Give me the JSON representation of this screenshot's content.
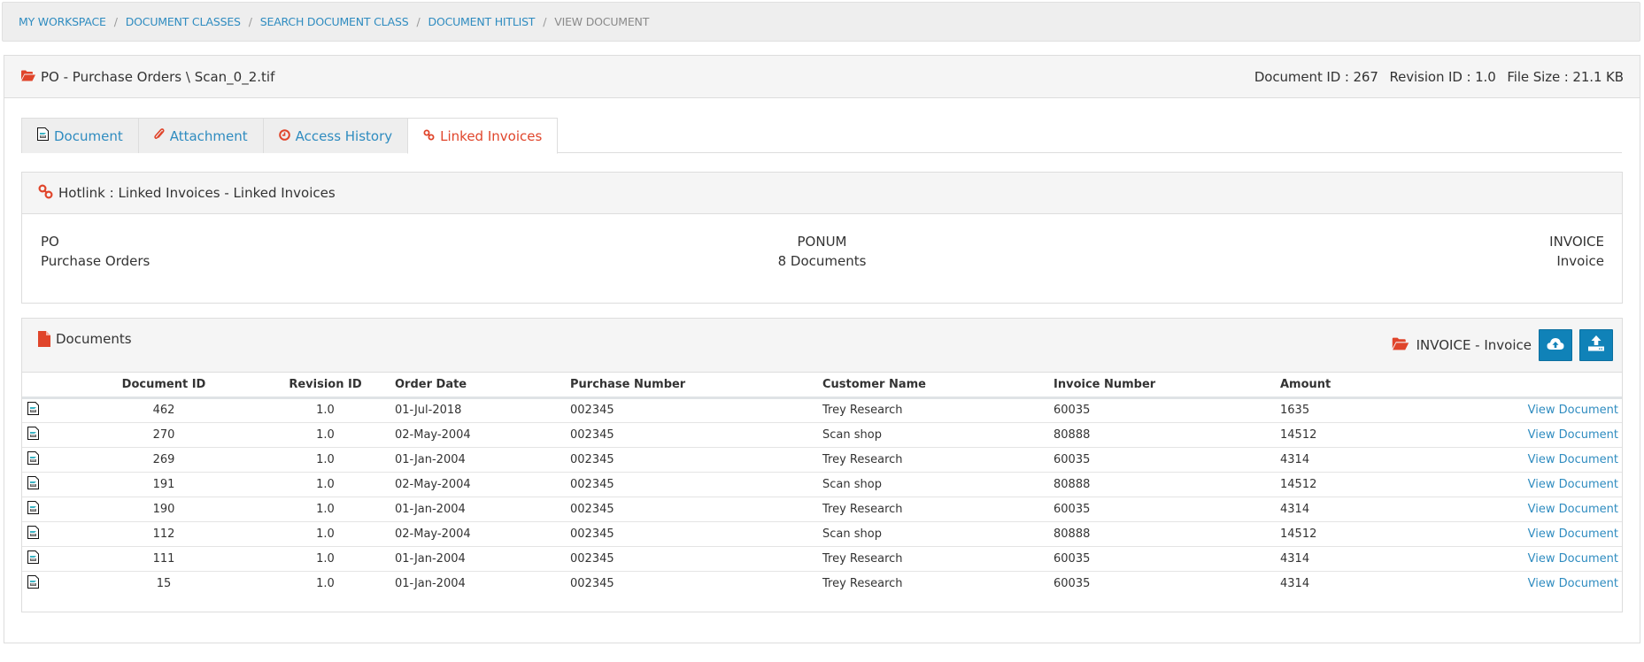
{
  "breadcrumb": {
    "items": [
      "MY WORKSPACE",
      "DOCUMENT CLASSES",
      "SEARCH DOCUMENT CLASS",
      "DOCUMENT HITLIST"
    ],
    "current": "VIEW DOCUMENT",
    "separator": "/"
  },
  "header": {
    "title": "PO - Purchase Orders \\ Scan_0_2.tif",
    "document_id": "Document ID : 267",
    "revision_id": "Revision ID : 1.0",
    "file_size": "File Size : 21.1 KB",
    "icon": "folder-open-icon"
  },
  "tabs": [
    {
      "label": "Document",
      "icon": "scanned-document-icon",
      "active": false
    },
    {
      "label": "Attachment",
      "icon": "paperclip-icon",
      "active": false
    },
    {
      "label": "Access History",
      "icon": "clock-icon",
      "active": false
    },
    {
      "label": "Linked Invoices",
      "icon": "link-icon",
      "active": true
    }
  ],
  "hotlink": {
    "title": "Hotlink : Linked Invoices - Linked Invoices",
    "left": {
      "code": "PO",
      "name": "Purchase Orders"
    },
    "center": {
      "field": "PONUM",
      "count": "8 Documents"
    },
    "right": {
      "code": "INVOICE",
      "name": "Invoice"
    }
  },
  "documents": {
    "title": "Documents",
    "target_class": "INVOICE - Invoice",
    "buttons": {
      "upload_cloud": "cloud-upload-icon",
      "upload": "upload-icon"
    },
    "columns": [
      "",
      "Document ID",
      "Revision ID",
      "Order Date",
      "Purchase Number",
      "Customer Name",
      "Invoice Number",
      "Amount",
      ""
    ],
    "link_label": "View Document",
    "rows": [
      {
        "doc_id": "462",
        "rev": "1.0",
        "date": "01-Jul-2018",
        "po": "002345",
        "customer": "Trey Research",
        "invoice": "60035",
        "amount": "1635"
      },
      {
        "doc_id": "270",
        "rev": "1.0",
        "date": "02-May-2004",
        "po": "002345",
        "customer": "Scan shop",
        "invoice": "80888",
        "amount": "14512"
      },
      {
        "doc_id": "269",
        "rev": "1.0",
        "date": "01-Jan-2004",
        "po": "002345",
        "customer": "Trey Research",
        "invoice": "60035",
        "amount": "4314"
      },
      {
        "doc_id": "191",
        "rev": "1.0",
        "date": "02-May-2004",
        "po": "002345",
        "customer": "Scan shop",
        "invoice": "80888",
        "amount": "14512"
      },
      {
        "doc_id": "190",
        "rev": "1.0",
        "date": "01-Jan-2004",
        "po": "002345",
        "customer": "Trey Research",
        "invoice": "60035",
        "amount": "4314"
      },
      {
        "doc_id": "112",
        "rev": "1.0",
        "date": "02-May-2004",
        "po": "002345",
        "customer": "Scan shop",
        "invoice": "80888",
        "amount": "14512"
      },
      {
        "doc_id": "111",
        "rev": "1.0",
        "date": "01-Jan-2004",
        "po": "002345",
        "customer": "Trey Research",
        "invoice": "60035",
        "amount": "4314"
      },
      {
        "doc_id": "15",
        "rev": "1.0",
        "date": "01-Jan-2004",
        "po": "002345",
        "customer": "Trey Research",
        "invoice": "60035",
        "amount": "4314"
      }
    ]
  },
  "colors": {
    "link": "#2f8cc0",
    "accent_red": "#e0452b",
    "button_blue": "#1082b8",
    "panel_heading": "#f5f5f5",
    "breadcrumb_bg": "#eeeeee"
  }
}
